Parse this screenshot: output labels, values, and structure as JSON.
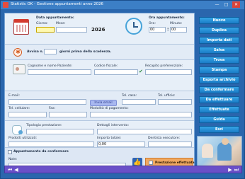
{
  "window": {
    "title": "Statistic OK - Gestione appuntamenti anno 2026",
    "minimize": "—",
    "maximize": "□",
    "close": "✕"
  },
  "appointment_date": {
    "label": "Data appuntamento:",
    "day_label": "Giorno:",
    "day_value": "",
    "month_label": "Mese:",
    "month_value": "",
    "year": "2026"
  },
  "appointment_time": {
    "label": "Ora appuntamento:",
    "hour_label": "Ora:",
    "hour_value": "00",
    "minute_label": "Minuto:",
    "minute_value": "00",
    "separator": ":"
  },
  "reminder": {
    "prefix": "Avvisa n.",
    "value": "",
    "suffix": "giorni prima della scadenza."
  },
  "patient": {
    "name_label": "Cognome e nome Paziente:",
    "name_value": "",
    "tax_code_label": "Codice fiscale:",
    "tax_code_value": "",
    "contact_label": "Recapito preferenziale:",
    "contact_value": ""
  },
  "contacts": {
    "email_label": "E-mail:",
    "email_value": "",
    "email_button": "Invia email",
    "home_phone_label": "Tel. casa:",
    "home_phone_value": "",
    "office_phone_label": "Tel. ufficio:",
    "office_phone_value": "",
    "mobile_label": "Tel. cellulare:",
    "mobile_value": "",
    "fax_label": "Fax:",
    "fax_value": "",
    "payment_label": "Modalità di pagamento:",
    "payment_value": ""
  },
  "service": {
    "type_label": "Tipologia prestazione:",
    "type_value": "",
    "details_label": "Dettagli intervento:",
    "details_value": "",
    "products_label": "Prodotti utilizzati:",
    "products_value": "",
    "amount_label": "Importo totale:",
    "amount_value": "0,00",
    "dentist_label": "Dentista esecutore:",
    "dentist_value": ""
  },
  "confirm": {
    "label": "Appuntamento da confermare",
    "notes_label": "Note:",
    "notes_value": "",
    "done_label": "Prestazione effettuata"
  },
  "menu": [
    "Nuovo",
    "Duplica",
    "Importa dati",
    "Salva",
    "Trova",
    "Stampa",
    "Esporta archivio",
    "Da confermare",
    "Da effettuare",
    "Effettuate",
    "Guida",
    "Esci"
  ],
  "nav": {
    "first": "⏮",
    "prev": "◀",
    "next": "▶",
    "last": "⏭"
  },
  "colors": {
    "menu_button": "#1a7dc7",
    "navbar": "#6a50c8",
    "done_box": "#f0a860"
  }
}
